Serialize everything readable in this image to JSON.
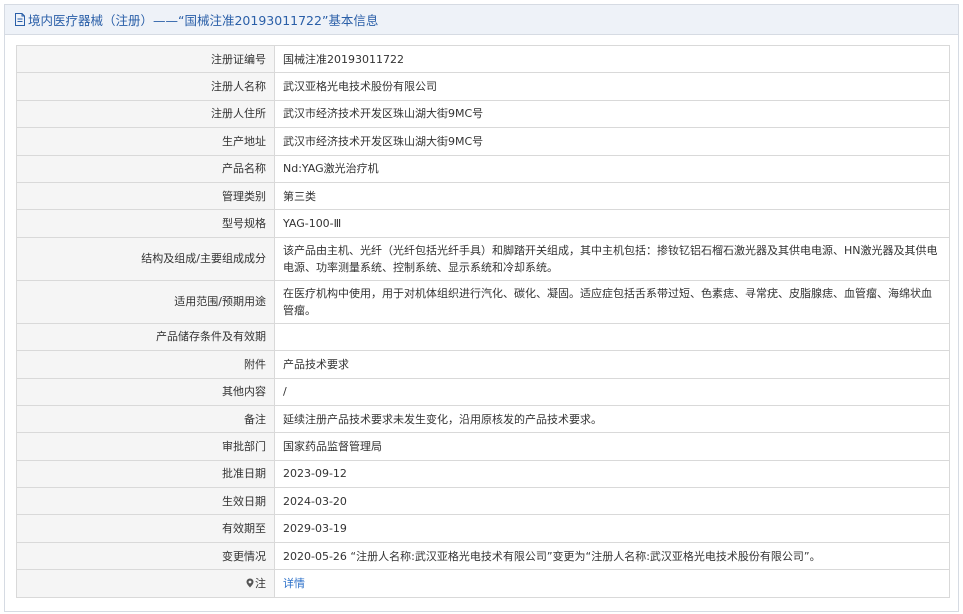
{
  "header": {
    "title": "境内医疗器械（注册）——“国械注准20193011722”基本信息"
  },
  "rows": [
    {
      "label": "注册证编号",
      "value": "国械注准20193011722"
    },
    {
      "label": "注册人名称",
      "value": "武汉亚格光电技术股份有限公司"
    },
    {
      "label": "注册人住所",
      "value": "武汉市经济技术开发区珠山湖大街9MC号"
    },
    {
      "label": "生产地址",
      "value": "武汉市经济技术开发区珠山湖大街9MC号"
    },
    {
      "label": "产品名称",
      "value": "Nd:YAG激光治疗机"
    },
    {
      "label": "管理类别",
      "value": "第三类"
    },
    {
      "label": "型号规格",
      "value": "YAG-100-Ⅲ"
    },
    {
      "label": "结构及组成/主要组成成分",
      "value": "该产品由主机、光纤（光纤包括光纤手具）和脚踏开关组成，其中主机包括：掺钕钇铝石榴石激光器及其供电电源、HN激光器及其供电电源、功率测量系统、控制系统、显示系统和冷却系统。"
    },
    {
      "label": "适用范围/预期用途",
      "value": "在医疗机构中使用，用于对机体组织进行汽化、碳化、凝固。适应症包括舌系带过短、色素痣、寻常疣、皮脂腺痣、血管瘤、海绵状血管瘤。"
    },
    {
      "label": "产品储存条件及有效期",
      "value": ""
    },
    {
      "label": "附件",
      "value": "产品技术要求"
    },
    {
      "label": "其他内容",
      "value": "/"
    },
    {
      "label": "备注",
      "value": "延续注册产品技术要求未发生变化，沿用原核发的产品技术要求。"
    },
    {
      "label": "审批部门",
      "value": "国家药品监督管理局"
    },
    {
      "label": "批准日期",
      "value": "2023-09-12"
    },
    {
      "label": "生效日期",
      "value": "2024-03-20"
    },
    {
      "label": "有效期至",
      "value": "2029-03-19"
    },
    {
      "label": "变更情况",
      "value": "2020-05-26 “注册人名称:武汉亚格光电技术有限公司”变更为“注册人名称:武汉亚格光电技术股份有限公司”。"
    },
    {
      "label": "注",
      "value": "详情"
    }
  ],
  "colors": {
    "accent": "#2a5fa8",
    "link": "#2a6fc9",
    "label_bg": "#f5f5f5",
    "header_bg": "#eef2f8"
  },
  "icons": {
    "title_icon": "document-icon",
    "note_icon": "pin-icon"
  }
}
